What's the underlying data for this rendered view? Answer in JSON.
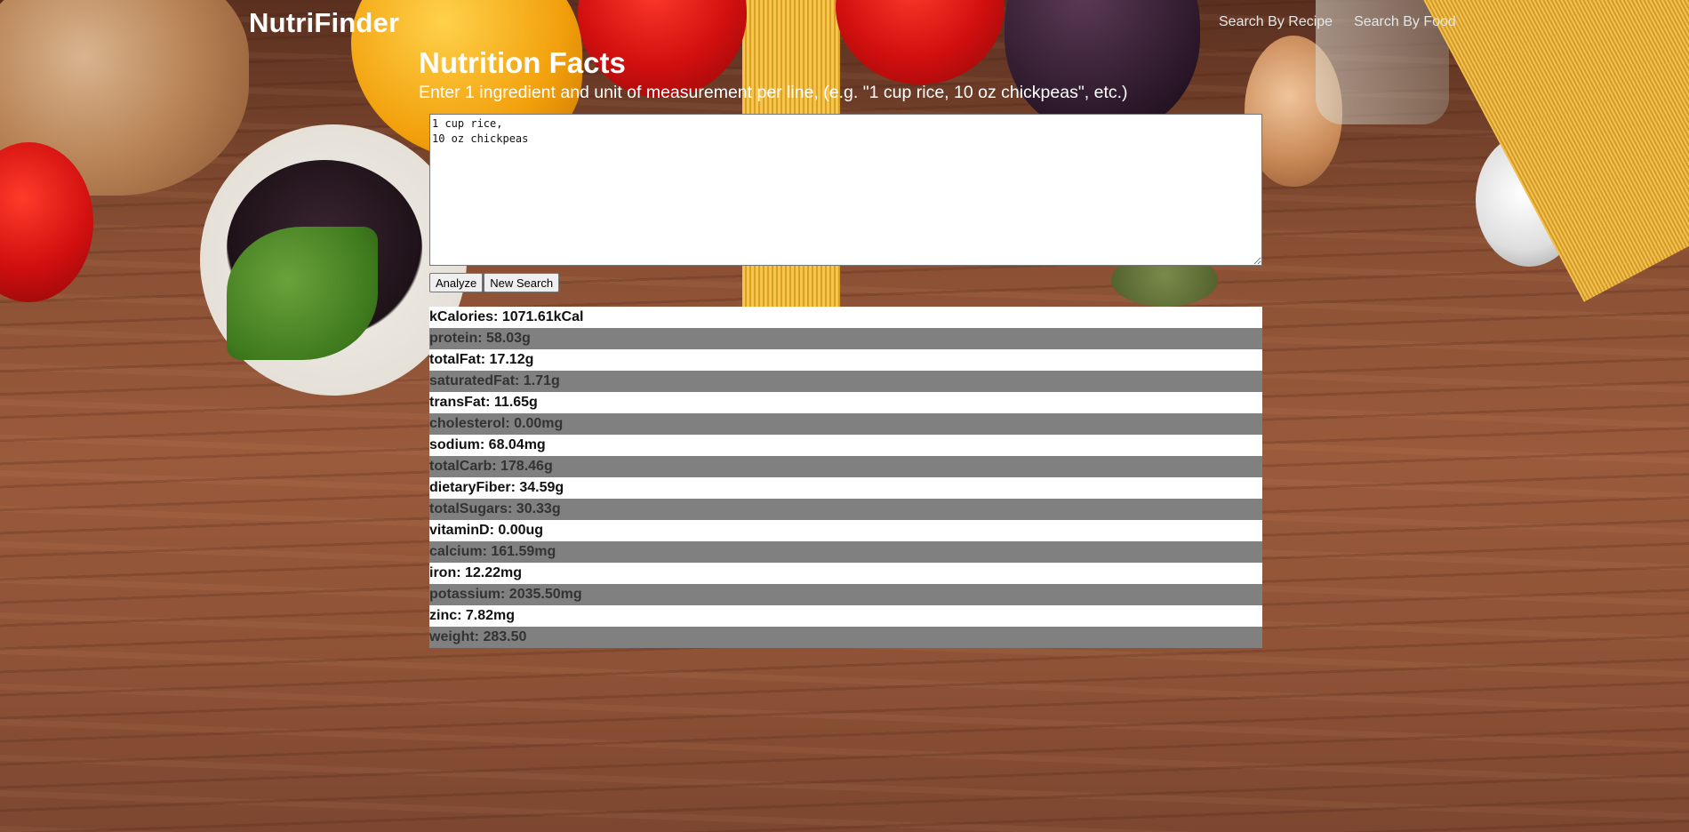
{
  "navbar": {
    "brand": "NutriFinder",
    "links": [
      "Search By Recipe",
      "Search By Food"
    ]
  },
  "main": {
    "title": "Nutrition Facts",
    "instructions": "Enter 1 ingredient and unit of measurement per line, (e.g. \"1 cup rice, 10 oz chickpeas\", etc.)",
    "ingredients_value": "1 cup rice,\n10 oz chickpeas",
    "buttons": {
      "analyze": "Analyze",
      "new_search": "New Search"
    }
  },
  "results": [
    "kCalories: 1071.61kCal",
    "protein: 58.03g",
    "totalFat: 17.12g",
    "saturatedFat: 1.71g",
    "transFat: 11.65g",
    "cholesterol: 0.00mg",
    "sodium: 68.04mg",
    "totalCarb: 178.46g",
    "dietaryFiber: 34.59g",
    "totalSugars: 30.33g",
    "vitaminD: 0.00ug",
    "calcium: 161.59mg",
    "iron: 12.22mg",
    "potassium: 2035.50mg",
    "zinc: 7.82mg",
    "weight: 283.50"
  ]
}
